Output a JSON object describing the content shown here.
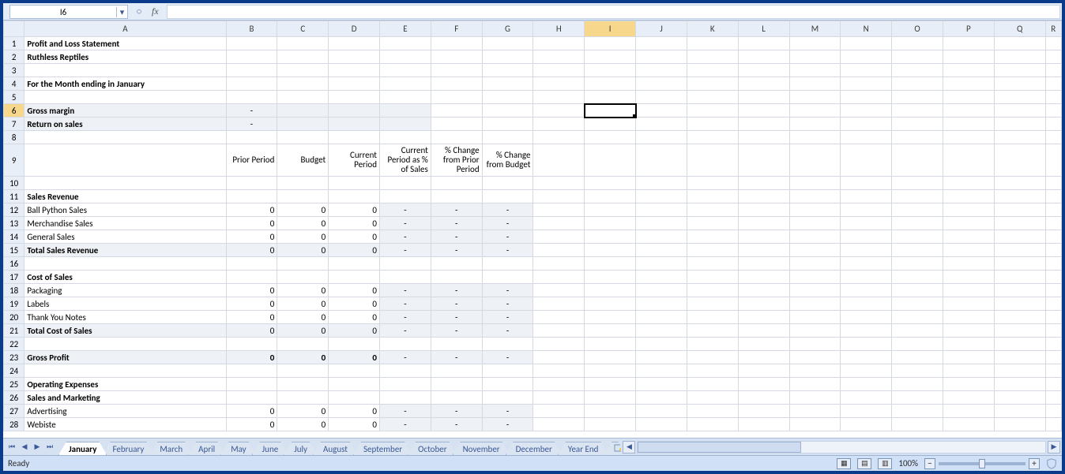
{
  "nameBox": "I6",
  "formula": "",
  "fxLabel": "fx",
  "columns": [
    "A",
    "B",
    "C",
    "D",
    "E",
    "F",
    "G",
    "H",
    "I",
    "J",
    "K",
    "L",
    "M",
    "N",
    "O",
    "P",
    "Q",
    "R"
  ],
  "activeCol": "I",
  "activeRow": 6,
  "rows": [
    {
      "n": 1,
      "A": "Profit and Loss Statement",
      "cls": {
        "A": "title-cell"
      }
    },
    {
      "n": 2,
      "A": "Ruthless Reptiles",
      "cls": {
        "A": "bold"
      }
    },
    {
      "n": 3
    },
    {
      "n": 4,
      "A": "For the Month ending in January",
      "cls": {
        "A": "bold"
      }
    },
    {
      "n": 5
    },
    {
      "n": 6,
      "A": "Gross margin",
      "B": "-",
      "shaded": [
        "A",
        "B",
        "C",
        "D",
        "E"
      ],
      "cls": {
        "A": "bold",
        "B": "center"
      }
    },
    {
      "n": 7,
      "A": "Return on sales",
      "B": "-",
      "shaded": [
        "A",
        "B",
        "C",
        "D",
        "E"
      ],
      "cls": {
        "A": "bold",
        "B": "center"
      }
    },
    {
      "n": 8
    },
    {
      "n": 9,
      "tall": true,
      "B": "Prior Period",
      "C": "Budget",
      "D": "Current Period",
      "E": "Current Period as % of Sales",
      "F": "% Change from Prior Period",
      "G": "% Change from Budget",
      "cls": {
        "B": "hdr",
        "C": "hdr",
        "D": "hdr",
        "E": "hdr",
        "F": "hdr",
        "G": "hdr"
      }
    },
    {
      "n": 10
    },
    {
      "n": 11,
      "A": "Sales Revenue",
      "cls": {
        "A": "bold"
      }
    },
    {
      "n": 12,
      "A": "Ball Python Sales",
      "B": "0",
      "C": "0",
      "D": "0",
      "E": "-",
      "F": "-",
      "G": "-",
      "shaded": [
        "E",
        "F",
        "G"
      ],
      "cls": {
        "B": "right",
        "C": "right",
        "D": "right",
        "E": "center",
        "F": "center",
        "G": "center"
      }
    },
    {
      "n": 13,
      "A": "Merchandise Sales",
      "B": "0",
      "C": "0",
      "D": "0",
      "E": "-",
      "F": "-",
      "G": "-",
      "shaded": [
        "E",
        "F",
        "G"
      ],
      "cls": {
        "B": "right",
        "C": "right",
        "D": "right",
        "E": "center",
        "F": "center",
        "G": "center"
      }
    },
    {
      "n": 14,
      "A": "General Sales",
      "B": "0",
      "C": "0",
      "D": "0",
      "E": "-",
      "F": "-",
      "G": "-",
      "shaded": [
        "E",
        "F",
        "G"
      ],
      "cls": {
        "B": "right",
        "C": "right",
        "D": "right",
        "E": "center",
        "F": "center",
        "G": "center"
      }
    },
    {
      "n": 15,
      "A": "Total Sales Revenue",
      "B": "0",
      "C": "0",
      "D": "0",
      "E": "-",
      "F": "-",
      "G": "-",
      "shaded": [
        "A",
        "B",
        "C",
        "D",
        "E",
        "F",
        "G"
      ],
      "cls": {
        "A": "bold",
        "B": "right",
        "C": "right",
        "D": "right",
        "E": "center",
        "F": "center",
        "G": "center"
      }
    },
    {
      "n": 16
    },
    {
      "n": 17,
      "A": "Cost of Sales",
      "cls": {
        "A": "bold"
      }
    },
    {
      "n": 18,
      "A": "Packaging",
      "B": "0",
      "C": "0",
      "D": "0",
      "E": "-",
      "F": "-",
      "G": "-",
      "shaded": [
        "E",
        "F",
        "G"
      ],
      "cls": {
        "B": "right",
        "C": "right",
        "D": "right",
        "E": "center",
        "F": "center",
        "G": "center"
      }
    },
    {
      "n": 19,
      "A": "Labels",
      "B": "0",
      "C": "0",
      "D": "0",
      "E": "-",
      "F": "-",
      "G": "-",
      "shaded": [
        "E",
        "F",
        "G"
      ],
      "cls": {
        "B": "right",
        "C": "right",
        "D": "right",
        "E": "center",
        "F": "center",
        "G": "center"
      }
    },
    {
      "n": 20,
      "A": "Thank You Notes",
      "B": "0",
      "C": "0",
      "D": "0",
      "E": "-",
      "F": "-",
      "G": "-",
      "shaded": [
        "E",
        "F",
        "G"
      ],
      "cls": {
        "B": "right",
        "C": "right",
        "D": "right",
        "E": "center",
        "F": "center",
        "G": "center"
      }
    },
    {
      "n": 21,
      "A": "Total Cost of Sales",
      "B": "0",
      "C": "0",
      "D": "0",
      "E": "-",
      "F": "-",
      "G": "-",
      "shaded": [
        "A",
        "B",
        "C",
        "D",
        "E",
        "F",
        "G"
      ],
      "cls": {
        "A": "bold",
        "B": "right",
        "C": "right",
        "D": "right",
        "E": "center",
        "F": "center",
        "G": "center"
      }
    },
    {
      "n": 22
    },
    {
      "n": 23,
      "A": "Gross Profit",
      "B": "0",
      "C": "0",
      "D": "0",
      "E": "-",
      "F": "-",
      "G": "-",
      "shaded": [
        "A",
        "B",
        "C",
        "D",
        "E",
        "F",
        "G"
      ],
      "cls": {
        "A": "bold",
        "B": "right bold",
        "C": "right bold",
        "D": "right bold",
        "E": "center",
        "F": "center",
        "G": "center"
      }
    },
    {
      "n": 24
    },
    {
      "n": 25,
      "A": "Operating Expenses",
      "cls": {
        "A": "bold"
      }
    },
    {
      "n": 26,
      "A": "Sales and Marketing",
      "cls": {
        "A": "blue"
      }
    },
    {
      "n": 27,
      "A": "Advertising",
      "B": "0",
      "C": "0",
      "D": "0",
      "E": "-",
      "F": "-",
      "G": "-",
      "shaded": [
        "E",
        "F",
        "G"
      ],
      "cls": {
        "B": "right",
        "C": "right",
        "D": "right",
        "E": "center",
        "F": "center",
        "G": "center"
      }
    },
    {
      "n": 28,
      "A": "Webiste",
      "B": "0",
      "C": "0",
      "D": "0",
      "E": "-",
      "F": "-",
      "G": "-",
      "shaded": [
        "E",
        "F",
        "G"
      ],
      "cls": {
        "B": "right",
        "C": "right",
        "D": "right",
        "E": "center",
        "F": "center",
        "G": "center"
      }
    }
  ],
  "sheetTabs": [
    "January",
    "February",
    "March",
    "April",
    "May",
    "June",
    "July",
    "August",
    "September",
    "October",
    "November",
    "December",
    "Year End"
  ],
  "activeTab": "January",
  "status": "Ready",
  "zoom": "100%"
}
